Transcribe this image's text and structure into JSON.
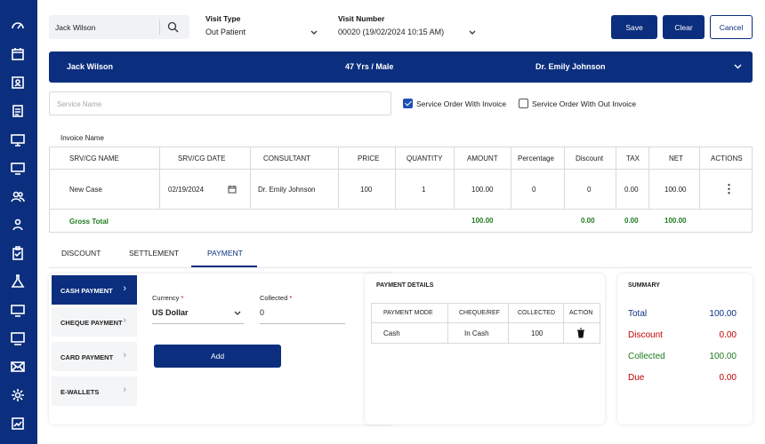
{
  "sidebar": {
    "icons": [
      "dashboard-icon",
      "calendar-icon",
      "patient-card-icon",
      "checklist-icon",
      "monitor-icon",
      "desktop-icon",
      "users-icon",
      "group-icon",
      "clipboard-icon",
      "flask-icon",
      "display-icon",
      "screen-icon",
      "mail-icon",
      "gear-icon",
      "report-icon",
      "add-icon"
    ]
  },
  "header": {
    "patient_search": "Jack Wilson",
    "visit_type_label": "Visit Type",
    "visit_type_value": "Out Patient",
    "visit_number_label": "Visit Number",
    "visit_number_value": "00020 (19/02/2024 10:15 AM)",
    "save_label": "Save",
    "clear_label": "Clear",
    "cancel_label": "Cancel"
  },
  "banner": {
    "name": "Jack Wilson",
    "age_gender": "47 Yrs / Male",
    "doctor": "Dr. Emily Johnson"
  },
  "service": {
    "placeholder": "Service Name",
    "with_invoice_label": "Service Order With Invoice",
    "with_invoice_checked": true,
    "without_invoice_label": "Service Order With Out Invoice",
    "without_invoice_checked": false
  },
  "invoice": {
    "title": "Invoice Name",
    "columns": [
      "SRV/CG NAME",
      "SRV/CG DATE",
      "CONSULTANT",
      "PRICE",
      "QUANTITY",
      "AMOUNT",
      "Percentage",
      "Discount",
      "TAX",
      "NET",
      "ACTIONS"
    ],
    "row": {
      "name": "New Case",
      "date": "02/19/2024",
      "consultant": "Dr. Emily Johnson",
      "price": "100",
      "quantity": "1",
      "amount": "100.00",
      "percentage": "0",
      "discount": "0",
      "tax": "0.00",
      "net": "100.00",
      "actions": "⋮"
    },
    "gross": {
      "label": "Gross Total",
      "amount": "100.00",
      "discount": "0.00",
      "tax": "0.00",
      "net": "100.00"
    }
  },
  "tabs": [
    "DISCOUNT",
    "SETTLEMENT",
    "PAYMENT"
  ],
  "active_tab": "PAYMENT",
  "payment_modes": [
    "CASH PAYMENT",
    "CHEQUE PAYMENT",
    "CARD PAYMENT",
    "E-WALLETS"
  ],
  "payment_form": {
    "currency_label": "Currency",
    "currency_value": "US Dollar",
    "collected_label": "Collected",
    "collected_value": "0",
    "required_mark": "*",
    "add_label": "Add"
  },
  "payment_details": {
    "title": "PAYMENT DETAILS",
    "columns": [
      "PAYMENT MODE",
      "CHEQUE/REF",
      "COLLECTED",
      "ACTION"
    ],
    "row": {
      "mode": "Cash",
      "ref": "In Cash",
      "collected": "100"
    }
  },
  "summary": {
    "title": "SUMMARY",
    "total_label": "Total",
    "total_value": "100.00",
    "discount_label": "Discount",
    "discount_value": "0.00",
    "collected_label": "Collected",
    "collected_value": "100.00",
    "due_label": "Due",
    "due_value": "0.00"
  },
  "colors": {
    "brand": "#0b2f7e",
    "total": "#0b2f7e",
    "discount": "#c00000",
    "collected": "#1f7a1f",
    "due": "#c00000"
  }
}
